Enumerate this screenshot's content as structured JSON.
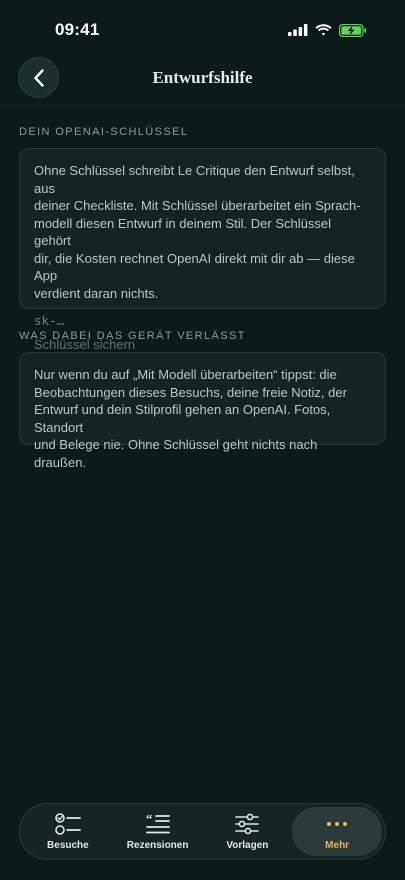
{
  "status": {
    "time": "09:41"
  },
  "header": {
    "title": "Entwurfshilfe"
  },
  "key_section": {
    "label": "DEIN OPENAI-SCHLÜSSEL",
    "description_lines": [
      "Ohne Schlüssel schreibt Le Critique den Entwurf selbst, aus",
      "deiner Checkliste. Mit Schlüssel überarbeitet ein Sprach-",
      "modell diesen Entwurf in deinem Stil. Der Schlüssel gehört",
      "dir, die Kosten rechnet OpenAI direkt mit dir ab — diese App",
      "verdient daran nichts."
    ],
    "input_placeholder": "sk-…",
    "input_value": "",
    "save_label": "Schlüssel sichern"
  },
  "privacy_section": {
    "label": "WAS DABEI DAS GERÄT VERLÄSST",
    "description_lines": [
      "Nur wenn du auf „Mit Modell überarbeiten“ tippst: die",
      "Beobachtungen dieses Besuchs, deine freie Notiz, der",
      "Entwurf und dein Stilprofil gehen an OpenAI. Fotos, Standort",
      "und Belege nie. Ohne Schlüssel geht nichts nach draußen."
    ]
  },
  "tab_bar": {
    "active_index": 3,
    "tabs": [
      {
        "label": "Besuche",
        "icon": "checklist-icon"
      },
      {
        "label": "Rezensionen",
        "icon": "quote-list-icon"
      },
      {
        "label": "Vorlagen",
        "icon": "sliders-icon"
      },
      {
        "label": "Mehr",
        "icon": "more-dots-icon"
      }
    ]
  },
  "colors": {
    "background": "#0c1a1a",
    "card": "#132423",
    "accent": "#e8b45f",
    "battery": "#5fd35a"
  }
}
